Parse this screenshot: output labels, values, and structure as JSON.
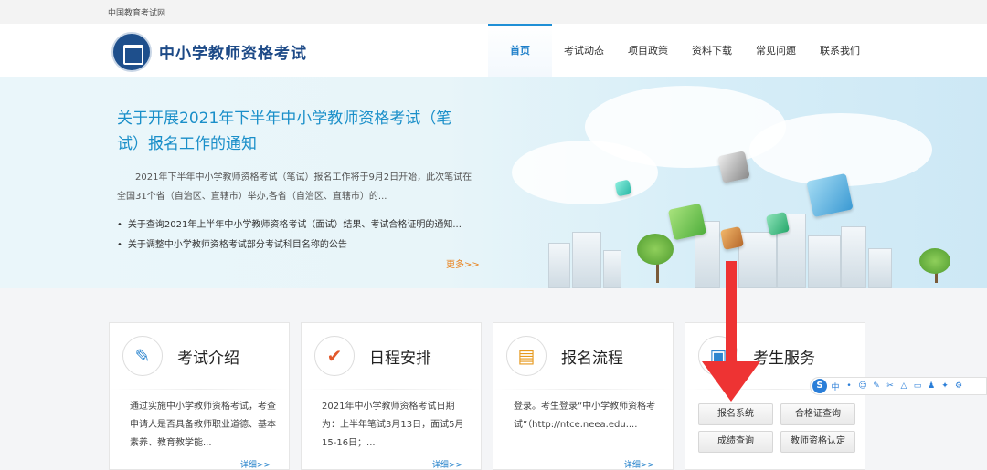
{
  "topbar": {
    "site": "中国教育考试网"
  },
  "header": {
    "title": "中小学教师资格考试",
    "nav": [
      "首页",
      "考试动态",
      "项目政策",
      "资料下载",
      "常见问题",
      "联系我们"
    ],
    "active_nav": "首页"
  },
  "banner": {
    "title": "关于开展2021年下半年中小学教师资格考试（笔试）报名工作的通知",
    "summary": "2021年下半年中小学教师资格考试（笔试）报名工作将于9月2日开始，此次笔试在全国31个省（自治区、直辖市）举办,各省（自治区、直辖市）的...",
    "links": [
      "关于查询2021年上半年中小学教师资格考试（面试）结果、考试合格证明的通知...",
      "关于调整中小学教师资格考试部分考试科目名称的公告"
    ],
    "more": "更多>>"
  },
  "cards": [
    {
      "title": "考试介绍",
      "icon": "document-edit-icon",
      "body": "通过实施中小学教师资格考试，考查申请人是否具备教师职业道德、基本素养、教育教学能...",
      "more": "详细>>"
    },
    {
      "title": "日程安排",
      "icon": "checkmark-icon",
      "body": "2021年中小学教师资格考试日期为：上半年笔试3月13日，面试5月15-16日；...",
      "more": "详细>>"
    },
    {
      "title": "报名流程",
      "icon": "form-icon",
      "body": "登录。考生登录“中小学教师资格考试”（http://ntce.neea.edu....",
      "more": "详细>>"
    }
  ],
  "service": {
    "title": "考生服务",
    "icon": "user-card-icon",
    "buttons": [
      "报名系统",
      "合格证查询",
      "成绩查询",
      "教师资格认定"
    ]
  },
  "toolbar": {
    "logo": "S",
    "lang": "中",
    "icons": [
      "•",
      "☺",
      "✎",
      "✂",
      "△",
      "▭",
      "♟",
      "✦",
      "⚙"
    ]
  },
  "colors": {
    "accent": "#1f8fd6",
    "title_blue": "#1d4a87",
    "annotation_arrow": "#e33333",
    "more_orange": "#e8821e"
  }
}
